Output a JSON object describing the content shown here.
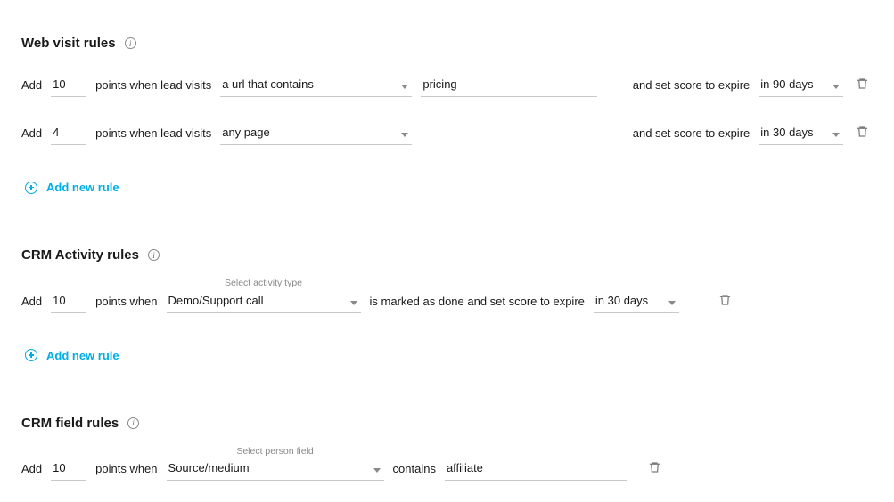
{
  "common": {
    "add_label": "Add",
    "add_rule_label": "Add new rule",
    "delete_label": "Delete rule",
    "info_label": "i"
  },
  "web": {
    "title": "Web visit rules",
    "points_text": "points when lead visits",
    "expire_text": "and set score to expire",
    "rules": [
      {
        "points": "10",
        "condition": "a url that contains",
        "url_value": "pricing",
        "expire": "in 90 days"
      },
      {
        "points": "4",
        "condition": "any page",
        "url_value": "",
        "expire": "in 30 days"
      }
    ]
  },
  "crm_activity": {
    "title": "CRM Activity rules",
    "points_text": "points when",
    "activity_label": "Select activity type",
    "done_expire_text": "is marked as done and set score to expire",
    "rules": [
      {
        "points": "10",
        "activity": "Demo/Support call",
        "expire": "in 30 days"
      }
    ]
  },
  "crm_field": {
    "title": "CRM field rules",
    "points_text": "points when",
    "field_label": "Select person field",
    "contains_text": "contains",
    "rules": [
      {
        "points": "10",
        "field": "Source/medium",
        "value": "affiliate"
      }
    ]
  }
}
